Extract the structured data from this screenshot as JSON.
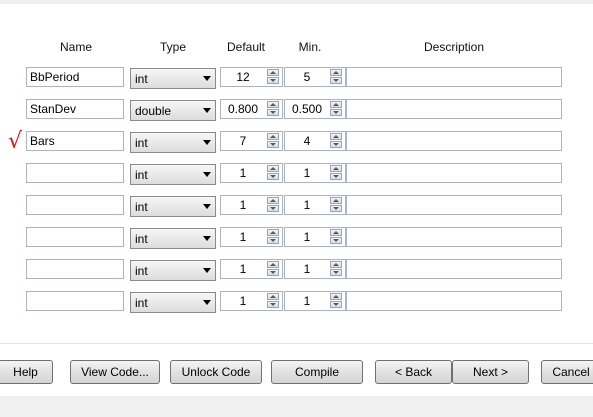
{
  "headers": {
    "name": "Name",
    "type": "Type",
    "default": "Default",
    "min": "Min.",
    "description": "Description"
  },
  "rows": [
    {
      "name": "BbPeriod",
      "type": "int",
      "default": "12",
      "min": "5",
      "description": ""
    },
    {
      "name": "StanDev",
      "type": "double",
      "default": "0.800",
      "min": "0.500",
      "description": ""
    },
    {
      "name": "Bars",
      "type": "int",
      "default": "7",
      "min": "4",
      "description": ""
    },
    {
      "name": "",
      "type": "int",
      "default": "1",
      "min": "1",
      "description": ""
    },
    {
      "name": "",
      "type": "int",
      "default": "1",
      "min": "1",
      "description": ""
    },
    {
      "name": "",
      "type": "int",
      "default": "1",
      "min": "1",
      "description": ""
    },
    {
      "name": "",
      "type": "int",
      "default": "1",
      "min": "1",
      "description": ""
    },
    {
      "name": "",
      "type": "int",
      "default": "1",
      "min": "1",
      "description": ""
    }
  ],
  "annotation": {
    "checkmark": "√",
    "color": "#e01010"
  },
  "buttons": {
    "help": "Help",
    "view_code": "View Code...",
    "unlock_code": "Unlock Code",
    "compile": "Compile",
    "back": "< Back",
    "next": "Next >",
    "cancel": "Cancel"
  }
}
